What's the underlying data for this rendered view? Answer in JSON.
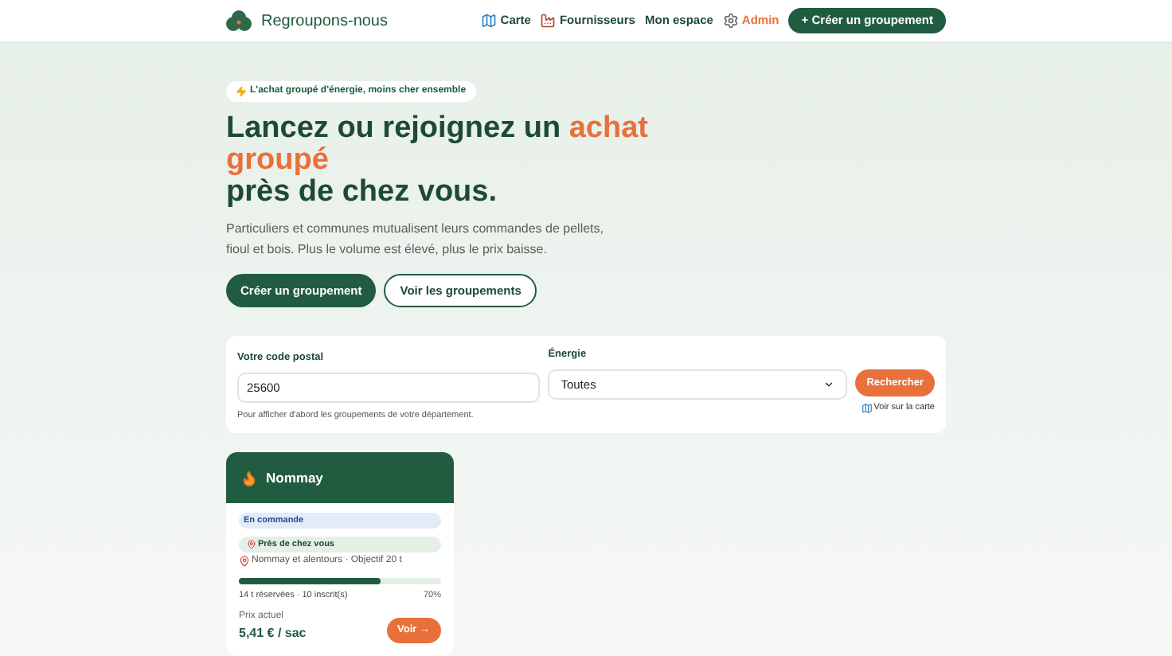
{
  "header": {
    "brand": "Regroupons-nous",
    "nav": [
      {
        "label": "Carte",
        "kind": "map"
      },
      {
        "label": "Fournisseurs",
        "kind": "factory"
      },
      {
        "label": "Mon espace",
        "kind": "plain"
      },
      {
        "label": "Admin",
        "kind": "admin"
      }
    ],
    "cta": "+ Créer un groupement"
  },
  "hero": {
    "badge": "L'achat groupé d'énergie, moins cher ensemble",
    "title_start": "Lancez ou rejoignez un ",
    "title_highlight": "achat groupé",
    "title_end": "près de chez vous.",
    "text": "Particuliers et communes mutualisent leurs commandes de pellets, fioul et bois. Plus le volume est élevé, plus le prix baisse.",
    "primary_button": "Créer un groupement",
    "secondary_button": "Voir les groupements"
  },
  "search": {
    "postal_label": "Votre code postal",
    "postal_value": "25600",
    "hint": "Pour afficher d'abord les groupements de votre département.",
    "energy_label": "Énergie",
    "energy_value": "Toutes",
    "button": "Rechercher",
    "map_link": "Voir sur la carte"
  },
  "groups": [
    {
      "name": "Nommay",
      "status": "En commande",
      "proximity": "Près de chez vous",
      "location": "Nommay et alentours · Objectif 20 t",
      "reserved": "14 t réservées · 10 inscrit(s)",
      "percent": "70%",
      "level": 0.7,
      "price_label": "Prix actuel",
      "price": "5,41 € / sac",
      "button": "Voir →"
    }
  ]
}
